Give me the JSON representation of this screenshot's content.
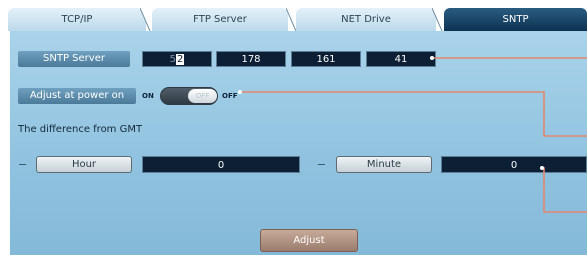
{
  "tabs": [
    {
      "label": "TCP/IP",
      "active": false
    },
    {
      "label": "FTP Server",
      "active": false
    },
    {
      "label": "NET Drive",
      "active": false
    },
    {
      "label": "SNTP",
      "active": true
    }
  ],
  "sntp": {
    "label": "SNTP Server",
    "octet1_prefix": "5",
    "octet1_selected": "2",
    "octet2": "178",
    "octet3": "161",
    "octet4": "41"
  },
  "power_on": {
    "label": "Adjust at power on",
    "on_label": "ON",
    "off_label": "OFF",
    "knob_label": "OFF",
    "state": "off"
  },
  "gmt": {
    "title": "The difference from GMT",
    "hour_label": "Hour",
    "hour_value": "0",
    "minute_label": "Minute",
    "minute_value": "0",
    "dash": "—"
  },
  "adjust_button": "Adjust",
  "colors": {
    "active_tab": "#0d3252",
    "panel": "#a9d3ea",
    "value_bg": "#0c1f34",
    "callout": "#e2876f"
  }
}
